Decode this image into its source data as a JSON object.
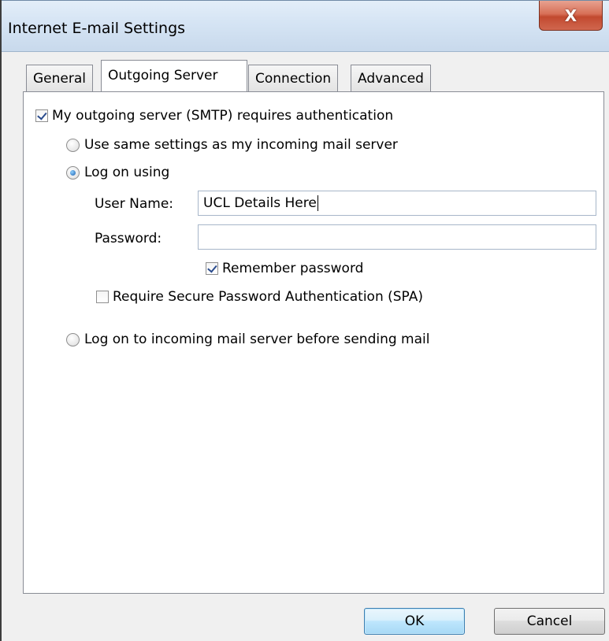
{
  "window": {
    "title": "Internet E-mail Settings",
    "close_label": "X"
  },
  "tabs": [
    {
      "label": "General",
      "active": false
    },
    {
      "label": "Outgoing Server",
      "active": true
    },
    {
      "label": "Connection",
      "active": false
    },
    {
      "label": "Advanced",
      "active": false
    }
  ],
  "outgoing": {
    "requires_auth": {
      "label": "My outgoing server (SMTP) requires authentication",
      "checked": true
    },
    "same_settings": {
      "label": "Use same settings as my incoming mail server",
      "selected": false
    },
    "log_on_using": {
      "label": "Log on using",
      "selected": true
    },
    "username": {
      "label": "User Name:",
      "value": "UCL Details Here"
    },
    "password": {
      "label": "Password:",
      "value": ""
    },
    "remember_password": {
      "label": "Remember password",
      "checked": true
    },
    "spa": {
      "label": "Require Secure Password Authentication (SPA)",
      "checked": false
    },
    "log_on_incoming": {
      "label": "Log on to incoming mail server before sending mail",
      "selected": false
    }
  },
  "buttons": {
    "ok": "OK",
    "cancel": "Cancel"
  }
}
